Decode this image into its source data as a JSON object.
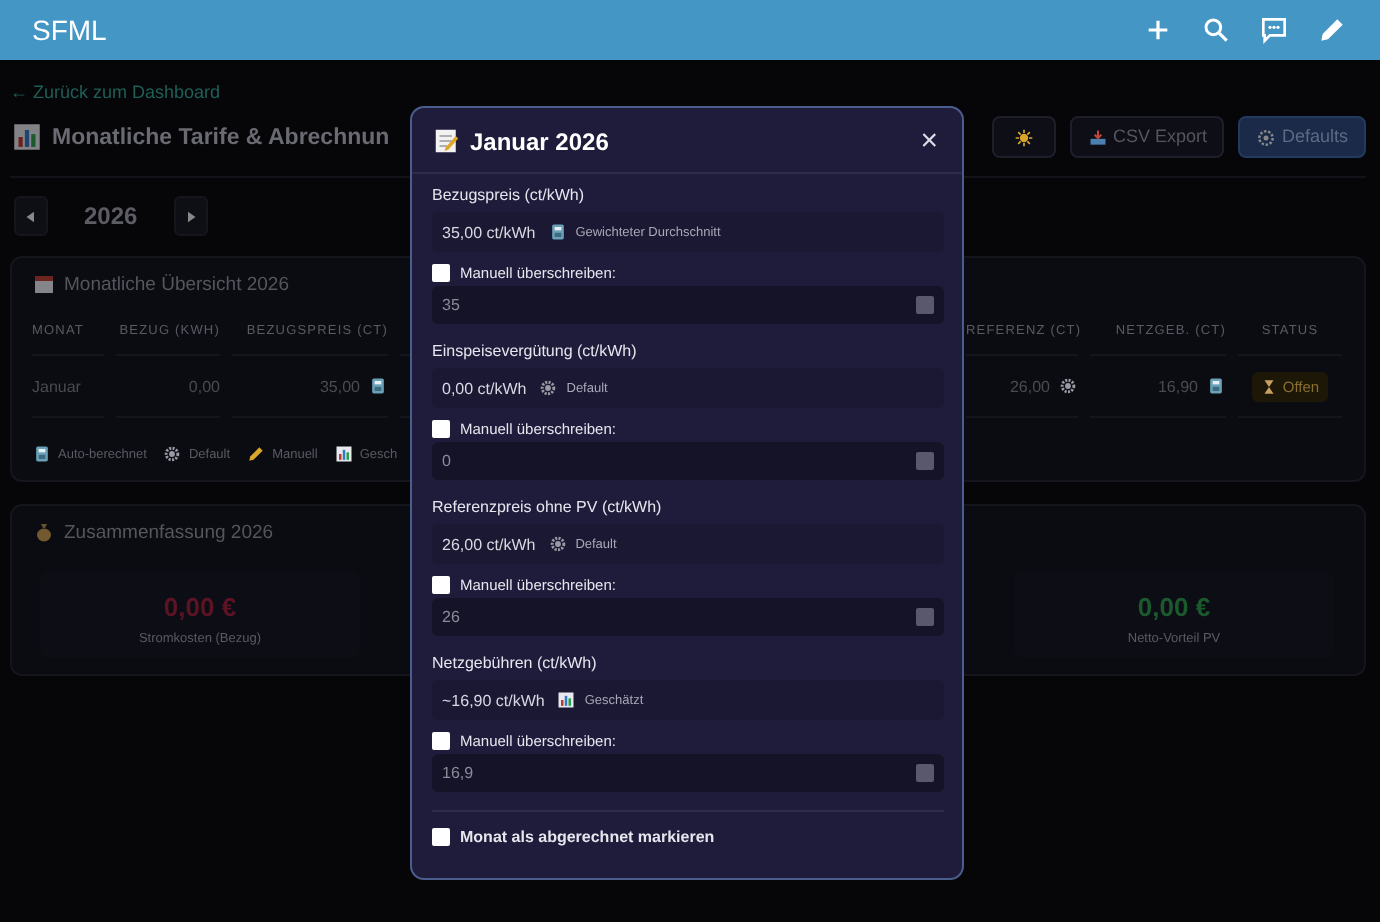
{
  "app_bar": {
    "title": "SFML",
    "actions": [
      {
        "kind": "add"
      },
      {
        "kind": "search"
      },
      {
        "kind": "chat"
      },
      {
        "kind": "edit"
      }
    ]
  },
  "page": {
    "back_link": "← Zurück zum Dashboard",
    "title": "Monatliche Tarife & Abrechnun",
    "actions": [
      {
        "kind": "theme"
      },
      {
        "kind": "export",
        "label": "CSV Export"
      },
      {
        "kind": "defaults",
        "label": "Defaults"
      }
    ],
    "year": "2026",
    "overview": {
      "title": "Monatliche Übersicht 2026",
      "columns": [
        "MONAT",
        "BEZUG (KWH)",
        "BEZUGSPREIS (CT)",
        "REFERENZ (CT)",
        "NETZGEB. (CT)",
        "STATUS"
      ],
      "rows": [
        {
          "month": "Januar",
          "bezug": "0,00",
          "bezugspreis": {
            "value": "35,00",
            "kind": "auto"
          },
          "referenz": {
            "value": "26,00",
            "kind": "default"
          },
          "netzgeb": {
            "value": "16,90",
            "kind": "auto"
          },
          "status": {
            "kind": "open",
            "label": "Offen"
          }
        }
      ],
      "legend": [
        {
          "kind": "auto",
          "label": "Auto-berechnet"
        },
        {
          "kind": "default",
          "label": "Default"
        },
        {
          "kind": "manual",
          "label": "Manuell"
        },
        {
          "kind": "estimated",
          "label": "Gesch"
        }
      ]
    },
    "summary": {
      "title": "Zusammenfassung 2026",
      "stats": [
        {
          "kind": "cost",
          "value": "0,00 €",
          "label": "Stromkosten (Bezug)"
        },
        {
          "kind": "benefit",
          "value": "0,00 €",
          "label": "Netto-Vorteil PV"
        }
      ]
    }
  },
  "dialog": {
    "title": "Januar 2026",
    "close": "×",
    "fields": [
      {
        "label": "Bezugspreis (ct/kWh)",
        "value": "35,00 ct/kWh",
        "source": {
          "kind": "auto",
          "label": "Gewichteter Durchschnitt"
        },
        "override": {
          "label": "Manuell überschreiben:",
          "checked": false
        },
        "input": "35"
      },
      {
        "label": "Einspeisevergütung (ct/kWh)",
        "value": "0,00 ct/kWh",
        "source": {
          "kind": "default",
          "label": "Default"
        },
        "override": {
          "label": "Manuell überschreiben:",
          "checked": false
        },
        "input": "0"
      },
      {
        "label": "Referenzpreis ohne PV (ct/kWh)",
        "value": "26,00 ct/kWh",
        "source": {
          "kind": "default",
          "label": "Default"
        },
        "override": {
          "label": "Manuell überschreiben:",
          "checked": false
        },
        "input": "26"
      },
      {
        "label": "Netzgebühren (ct/kWh)",
        "value": "~16,90 ct/kWh",
        "source": {
          "kind": "estimated",
          "label": "Geschätzt"
        },
        "override": {
          "label": "Manuell überschreiben:",
          "checked": false
        },
        "input": "16,9"
      }
    ],
    "settled": {
      "label": "Monat als abgerechnet markieren",
      "checked": false
    }
  }
}
